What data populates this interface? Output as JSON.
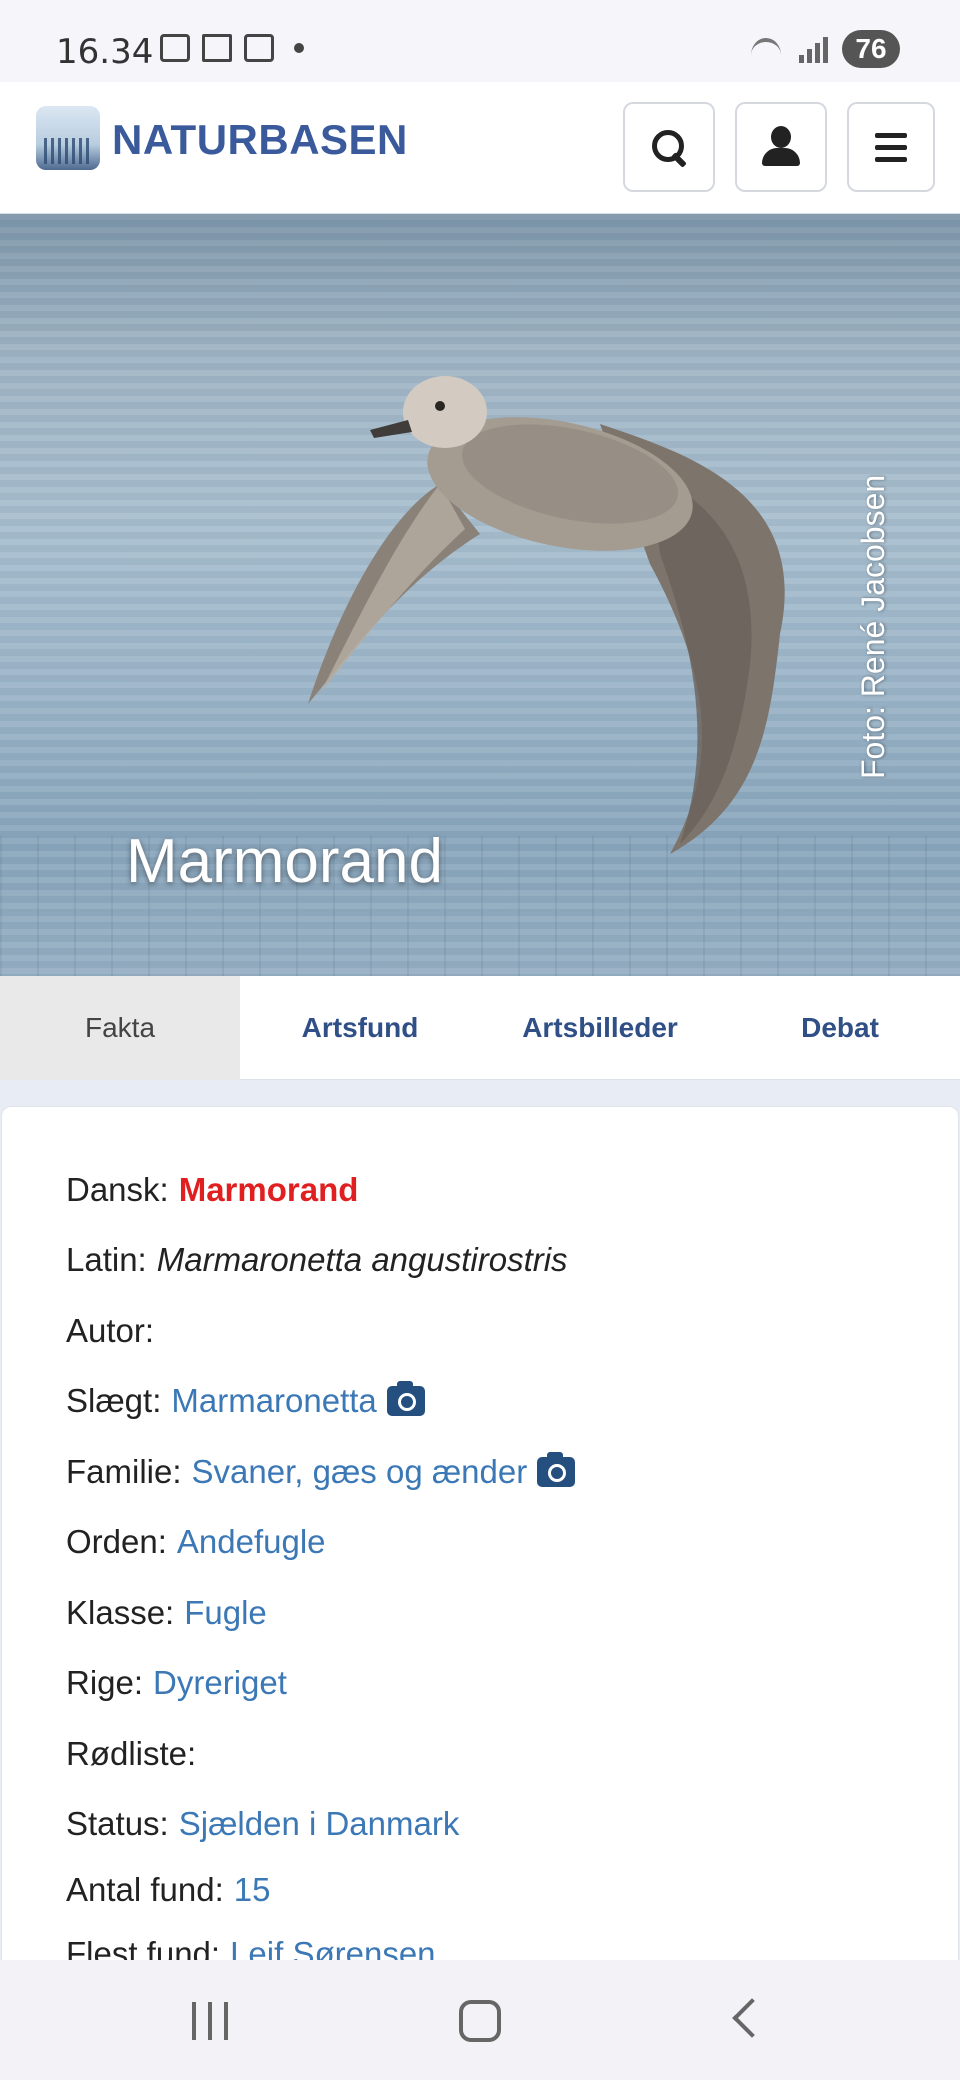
{
  "status_bar": {
    "time": "16.34",
    "battery": "76"
  },
  "header": {
    "brand": "NATURBASEN"
  },
  "hero": {
    "title": "Marmorand",
    "photo_credit": "Foto: René Jacobsen"
  },
  "tabs": [
    {
      "label": "Fakta",
      "active": true
    },
    {
      "label": "Artsfund",
      "active": false
    },
    {
      "label": "Artsbilleder",
      "active": false
    },
    {
      "label": "Debat",
      "active": false
    }
  ],
  "facts": {
    "dansk": {
      "label": "Dansk:",
      "value": "Marmorand"
    },
    "latin": {
      "label": "Latin:",
      "value": "Marmaronetta angustirostris"
    },
    "autor": {
      "label": "Autor:",
      "value": ""
    },
    "slaegt": {
      "label": "Slægt:",
      "value": "Marmaronetta"
    },
    "familie": {
      "label": "Familie:",
      "value": "Svaner, gæs og ænder"
    },
    "orden": {
      "label": "Orden:",
      "value": "Andefugle"
    },
    "klasse": {
      "label": "Klasse:",
      "value": "Fugle"
    },
    "rige": {
      "label": "Rige:",
      "value": "Dyreriget"
    },
    "roedliste": {
      "label": "Rødliste:",
      "value": ""
    },
    "status": {
      "label": "Status:",
      "value": "Sjælden i Danmark"
    },
    "antal_fund": {
      "label": "Antal fund:",
      "value": "15"
    },
    "flest_fund": {
      "label": "Flest fund:",
      "value": "Leif Sørensen"
    }
  },
  "colors": {
    "brand": "#3a5a9b",
    "link": "#3b78b5",
    "highlight": "#e02020",
    "camera_icon": "#244f7f"
  }
}
